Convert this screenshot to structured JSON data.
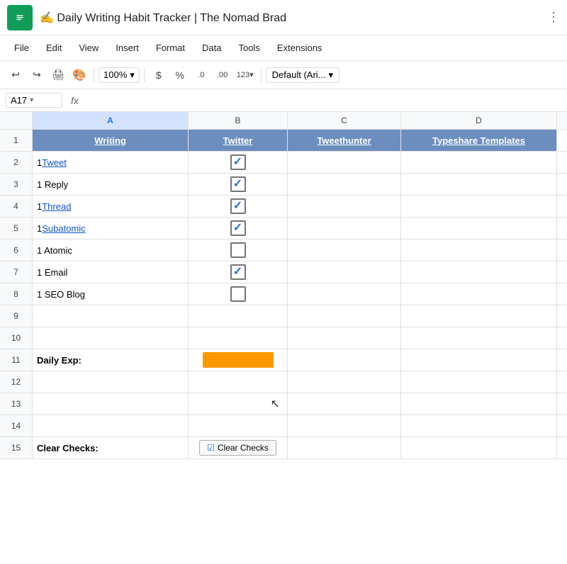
{
  "titleBar": {
    "emoji": "✍",
    "title": "Daily Writing Habit Tracker | The Nomad Brad",
    "dotsLabel": "⋮"
  },
  "menuBar": {
    "items": [
      "File",
      "Edit",
      "View",
      "Insert",
      "Format",
      "Data",
      "Tools",
      "Extensions"
    ]
  },
  "toolbar": {
    "zoom": "100%",
    "zoomArrow": "▾",
    "dollarSign": "$",
    "percentSign": "%",
    "decimal0": ".0",
    "decimal00": ".00",
    "moreFormats": "123▾",
    "fontFamily": "Default (Ari...",
    "fontArrow": "▾"
  },
  "formulaBar": {
    "cellRef": "A17",
    "cellRefArrow": "▾",
    "fx": "fx"
  },
  "columns": {
    "headers": [
      "A",
      "B",
      "C",
      "D"
    ],
    "widths": [
      220,
      140,
      160,
      220
    ]
  },
  "rows": {
    "headers": [
      "Writing",
      "Twitter",
      "Tweethunter",
      "Typeshare Templates"
    ],
    "data": [
      {
        "num": 2,
        "a": "1 Tweet",
        "aLink": true,
        "aLinkText": "Tweet",
        "bChecked": true,
        "cChecked": false,
        "dChecked": false
      },
      {
        "num": 3,
        "a": "1 Reply",
        "aLink": false,
        "bChecked": true,
        "cChecked": false,
        "dChecked": false
      },
      {
        "num": 4,
        "a": "1 Thread",
        "aLink": true,
        "aLinkText": "Thread",
        "bChecked": true,
        "cChecked": false,
        "dChecked": false
      },
      {
        "num": 5,
        "a": "1 Subatomic",
        "aLink": true,
        "aLinkText": "Subatomic",
        "bChecked": true,
        "cChecked": false,
        "dChecked": false
      },
      {
        "num": 6,
        "a": "1 Atomic",
        "aLink": false,
        "bChecked": false,
        "cChecked": false,
        "dChecked": false
      },
      {
        "num": 7,
        "a": "1 Email",
        "aLink": false,
        "bChecked": true,
        "cChecked": false,
        "dChecked": false
      },
      {
        "num": 8,
        "a": "1 SEO Blog",
        "aLink": false,
        "bChecked": false,
        "cChecked": false,
        "dChecked": false
      }
    ],
    "emptyRows": [
      9,
      10
    ],
    "row11": {
      "label": "Daily Exp:",
      "hasBar": true
    },
    "emptyRows2": [
      12,
      13,
      14
    ],
    "row15": {
      "label": "Clear Checks:",
      "btnLabel": "Clear Checks"
    }
  },
  "colors": {
    "headerBg": "#6c8ebf",
    "headerText": "#ffffff",
    "checkColor": "#1a73e8",
    "expBarColor": "#ff9800",
    "linkColor": "#1155cc"
  }
}
